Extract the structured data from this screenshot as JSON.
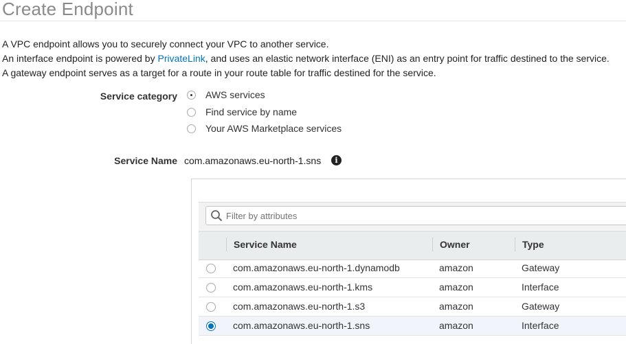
{
  "page": {
    "title": "Create Endpoint",
    "intro_line1": "A VPC endpoint allows you to securely connect your VPC to another service.",
    "intro_line2_pre": "An interface endpoint is powered by ",
    "intro_line2_link": "PrivateLink",
    "intro_line2_post": ", and uses an elastic network interface (ENI) as an entry point for traffic destined to the service.",
    "intro_line3": "A gateway endpoint serves as a target for a route in your route table for traffic destined for the service."
  },
  "service_category": {
    "label": "Service category",
    "options": [
      {
        "label": "AWS services",
        "selected": true
      },
      {
        "label": "Find service by name",
        "selected": false
      },
      {
        "label": "Your AWS Marketplace services",
        "selected": false
      }
    ]
  },
  "service_name": {
    "label": "Service Name",
    "value": "com.amazonaws.eu-north-1.sns",
    "info_icon": "info-icon"
  },
  "filter": {
    "placeholder": "Filter by attributes",
    "icon": "search-icon"
  },
  "table": {
    "columns": [
      "Service Name",
      "Owner",
      "Type"
    ],
    "rows": [
      {
        "service": "com.amazonaws.eu-north-1.dynamodb",
        "owner": "amazon",
        "type": "Gateway",
        "selected": false
      },
      {
        "service": "com.amazonaws.eu-north-1.kms",
        "owner": "amazon",
        "type": "Interface",
        "selected": false
      },
      {
        "service": "com.amazonaws.eu-north-1.s3",
        "owner": "amazon",
        "type": "Gateway",
        "selected": false
      },
      {
        "service": "com.amazonaws.eu-north-1.sns",
        "owner": "amazon",
        "type": "Interface",
        "selected": true
      }
    ]
  },
  "colors": {
    "link": "#0073bb",
    "selected_row": "#f1f4fa",
    "header_bg": "#eaeded"
  }
}
